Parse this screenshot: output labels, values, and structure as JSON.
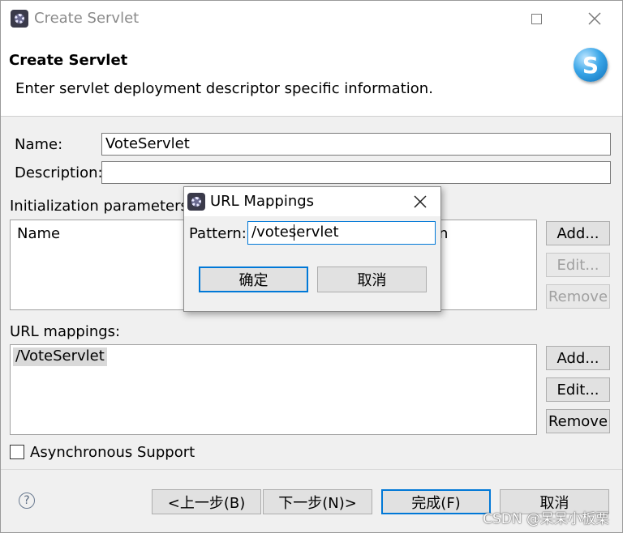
{
  "window": {
    "title": "Create Servlet",
    "header_title": "Create Servlet",
    "header_description": "Enter servlet deployment descriptor specific information.",
    "logo_letter": "S"
  },
  "form": {
    "name_label": "Name:",
    "name_value": "VoteServlet",
    "description_label": "Description:",
    "description_value": "",
    "init_params_label": "Initialization parameters:",
    "init_params_columns": [
      "Name",
      "n"
    ],
    "init_buttons": {
      "add": "Add...",
      "edit": "Edit...",
      "remove": "Remove"
    },
    "url_mappings_label": "URL mappings:",
    "url_mappings": [
      "/VoteServlet"
    ],
    "url_buttons": {
      "add": "Add...",
      "edit": "Edit...",
      "remove": "Remove"
    },
    "async_label": "Asynchronous Support",
    "async_checked": false
  },
  "footer": {
    "help_icon": "?",
    "back": "<上一步(B)",
    "next": "下一步(N)>",
    "finish": "完成(F)",
    "cancel": "取消"
  },
  "dialog": {
    "title": "URL Mappings",
    "pattern_label": "Pattern:",
    "pattern_value": "/voteservlet",
    "ok": "确定",
    "cancel": "取消"
  },
  "watermark": "CSDN @呆呆小板栗",
  "colors": {
    "focus": "#0078d7",
    "logo": "#3aa6e8"
  }
}
